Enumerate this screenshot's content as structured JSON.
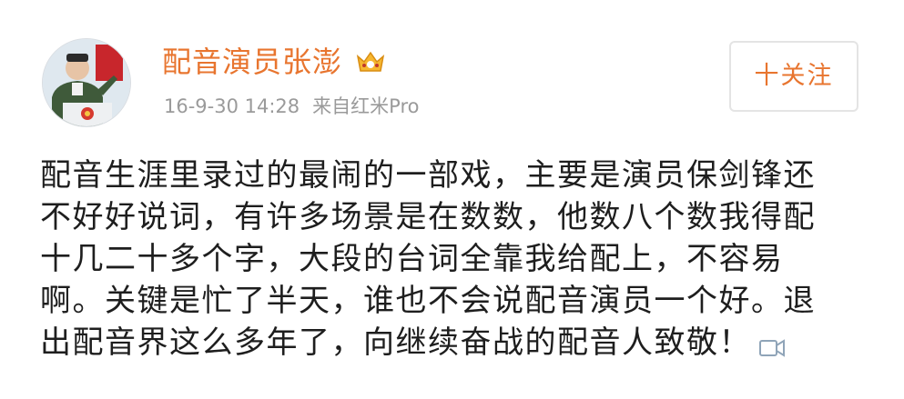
{
  "post": {
    "user": {
      "name": "配音演员张澎",
      "badge_icon": "vip-crown-icon",
      "name_color": "#e8752f"
    },
    "meta": {
      "time": "16-9-30 14:28",
      "source": "来自红米Pro"
    },
    "follow_button": {
      "label": "十关注"
    },
    "content_lines": [
      "配音生涯里录过的最闹的一部戏，主要是演员保剑锋还",
      "不好好说词，有许多场景是在数数，他数八个数我得配",
      "十几二十多个字，大段的台词全靠我给配上，不容易",
      "啊。关键是忙了半天，谁也不会说配音演员一个好。退",
      "出配音界这么多年了，向继续奋战的配音人致敬！"
    ],
    "trailing_icon": "video-icon"
  }
}
